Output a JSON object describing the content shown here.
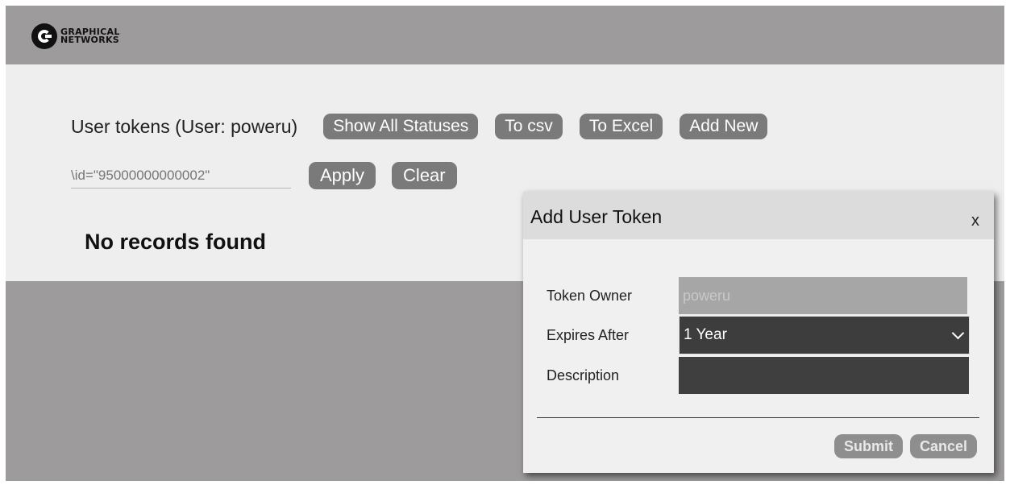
{
  "brand": {
    "line1": "GRAPHICAL",
    "line2": "NETWORKS"
  },
  "page": {
    "title": "User tokens (User: poweru)",
    "buttons": {
      "show_all": "Show All Statuses",
      "to_csv": "To csv",
      "to_excel": "To Excel",
      "add_new": "Add New"
    },
    "filter": {
      "value": "\\id=\"95000000000002\""
    },
    "filter_buttons": {
      "apply": "Apply",
      "clear": "Clear"
    },
    "empty_message": "No records found"
  },
  "dialog": {
    "title": "Add User Token",
    "close_label": "x",
    "fields": {
      "owner_label": "Token Owner",
      "owner_value": "poweru",
      "expires_label": "Expires After",
      "expires_value": "1 Year",
      "description_label": "Description",
      "description_value": ""
    },
    "buttons": {
      "submit": "Submit",
      "cancel": "Cancel"
    }
  },
  "icons": {
    "logo": "graphical-networks-logo-icon",
    "dropdown": "chevron-down-icon",
    "close": "close-icon"
  },
  "colors": {
    "header": "#9d9b9c",
    "content": "#eeeeee",
    "button": "#7a7a7a",
    "dialog_header": "#dcdcdc"
  }
}
